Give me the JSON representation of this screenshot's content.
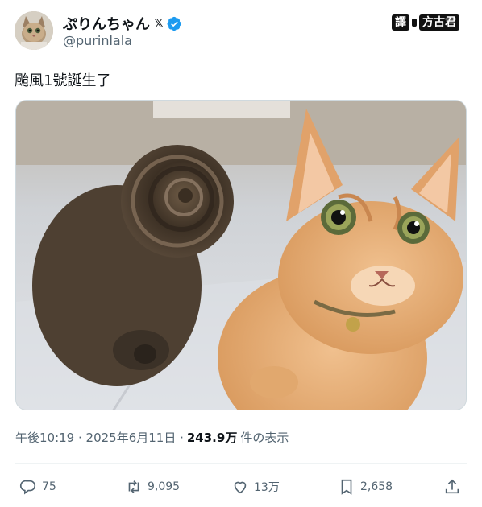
{
  "tweet": {
    "author": {
      "display_name": "ぷりんちゃん",
      "x_mark": "𝕏",
      "handle": "@purinlala",
      "verified": true,
      "avatar_icon": "cat-avatar-icon"
    },
    "translator_badge": {
      "label_1": "譯",
      "label_2": "方古君"
    },
    "text": "颱風1號誕生了",
    "image": {
      "description_icon": "two-cats-photo",
      "accent": "#e8a968"
    },
    "timestamp": "午後10:19 · 2025年6月11日 · ",
    "views_count": "243.9万",
    "views_label": "件の表示",
    "actions": {
      "reply": "75",
      "repost": "9,095",
      "like": "13万",
      "bookmark": "2,658"
    }
  },
  "colors": {
    "verified": "#1d9bf0",
    "muted": "#536471",
    "text": "#0f1419"
  }
}
